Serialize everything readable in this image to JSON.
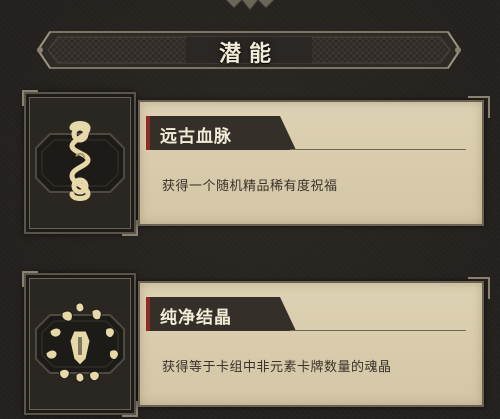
{
  "panel": {
    "title": "潜能"
  },
  "potentials": [
    {
      "name": "远古血脉",
      "description": "获得一个随机精品稀有度祝福",
      "icon": "ancient-bloodline-icon"
    },
    {
      "name": "纯净结晶",
      "description": "获得等于卡组中非元素卡牌数量的魂晶",
      "icon": "pure-crystal-icon"
    }
  ],
  "colors": {
    "background": "#24211e",
    "parchment": "#ded2b4",
    "name_tab": "#342f29",
    "icon_gold": "#e6d8a8",
    "title_text": "#f1ead7"
  }
}
